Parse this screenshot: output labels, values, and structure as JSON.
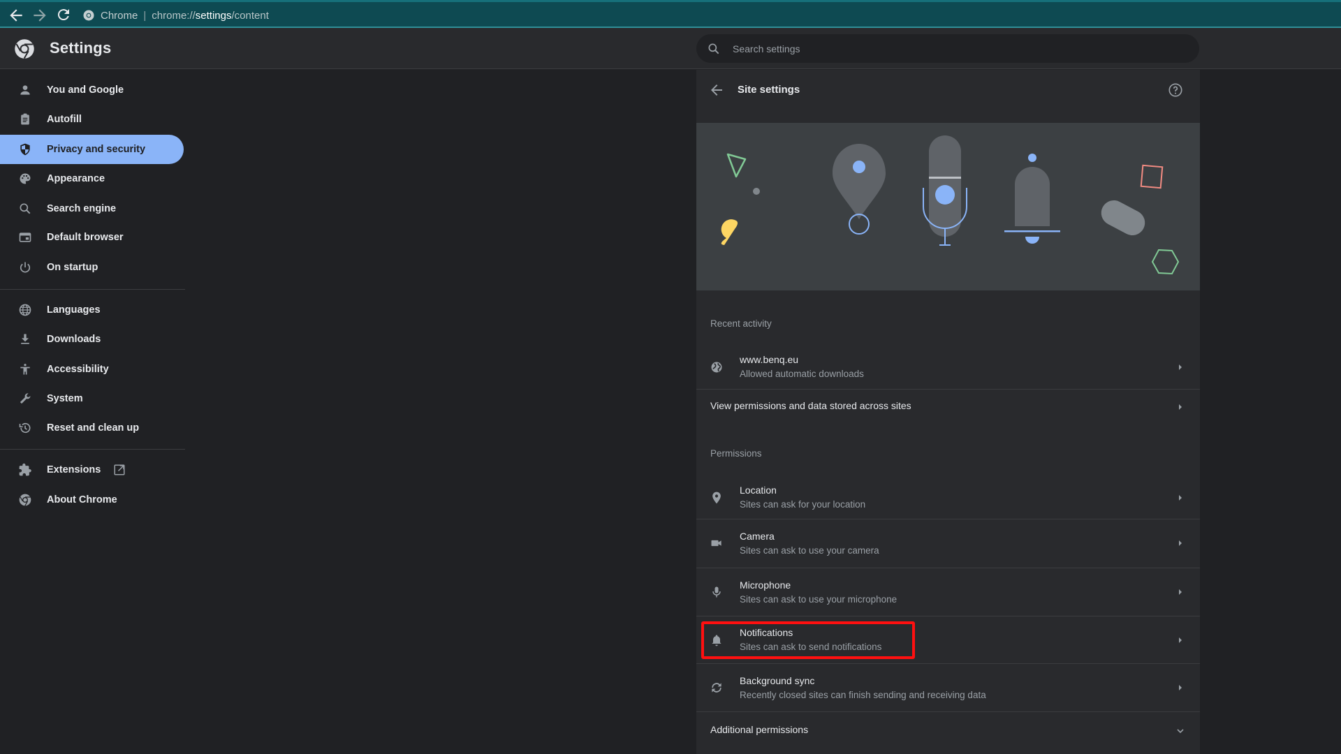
{
  "browser": {
    "site_label": "Chrome",
    "url_scheme": "chrome://",
    "url_host": "settings",
    "url_path": "/content",
    "nav": {
      "back": "back-icon",
      "forward": "forward-icon",
      "reload": "reload-icon"
    }
  },
  "header": {
    "title": "Settings",
    "search_placeholder": "Search settings"
  },
  "sidebar": {
    "items": [
      {
        "label": "You and Google",
        "icon": "person-icon",
        "selected": false
      },
      {
        "label": "Autofill",
        "icon": "clipboard-icon",
        "selected": false
      },
      {
        "label": "Privacy and security",
        "icon": "shield-icon",
        "selected": true
      },
      {
        "label": "Appearance",
        "icon": "palette-icon",
        "selected": false
      },
      {
        "label": "Search engine",
        "icon": "search-icon",
        "selected": false
      },
      {
        "label": "Default browser",
        "icon": "browser-window-icon",
        "selected": false
      },
      {
        "label": "On startup",
        "icon": "power-icon",
        "selected": false
      },
      {
        "label": "Languages",
        "icon": "globe-icon",
        "selected": false
      },
      {
        "label": "Downloads",
        "icon": "download-icon",
        "selected": false
      },
      {
        "label": "Accessibility",
        "icon": "accessibility-icon",
        "selected": false
      },
      {
        "label": "System",
        "icon": "wrench-icon",
        "selected": false
      },
      {
        "label": "Reset and clean up",
        "icon": "history-icon",
        "selected": false
      },
      {
        "label": "Extensions",
        "icon": "puzzle-icon",
        "selected": false,
        "external": true
      },
      {
        "label": "About Chrome",
        "icon": "chrome-icon",
        "selected": false
      }
    ]
  },
  "site_settings": {
    "title": "Site settings",
    "recent_activity_label": "Recent activity",
    "recent": [
      {
        "title": "www.benq.eu",
        "subtitle": "Allowed automatic downloads"
      }
    ],
    "view_all_label": "View permissions and data stored across sites",
    "permissions_label": "Permissions",
    "permissions": [
      {
        "title": "Location",
        "subtitle": "Sites can ask for your location",
        "icon": "location-pin-icon"
      },
      {
        "title": "Camera",
        "subtitle": "Sites can ask to use your camera",
        "icon": "camera-icon"
      },
      {
        "title": "Microphone",
        "subtitle": "Sites can ask to use your microphone",
        "icon": "microphone-icon"
      },
      {
        "title": "Notifications",
        "subtitle": "Sites can ask to send notifications",
        "icon": "bell-icon",
        "highlighted": true
      },
      {
        "title": "Background sync",
        "subtitle": "Recently closed sites can finish sending and receiving data",
        "icon": "sync-icon"
      }
    ],
    "additional_permissions_label": "Additional permissions"
  },
  "colors": {
    "accent": "#8ab4f8",
    "highlight_box": "#ff1010",
    "titlebar": "#0e4a52"
  }
}
